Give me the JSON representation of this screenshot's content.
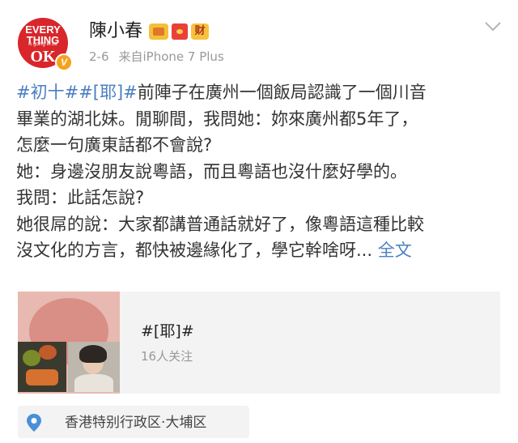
{
  "header": {
    "avatar": {
      "line1": "EVERY",
      "line2": "THING",
      "line3": "is going to be",
      "line4": "OK",
      "verified_mark": "V"
    },
    "username": "陳小春",
    "badges": [
      "crown-badge",
      "red-envelope-badge",
      "cai-badge"
    ],
    "badge_cai_label": "财",
    "date": "2-6",
    "source": "来自iPhone 7 Plus",
    "menu_icon": "chevron-down-icon"
  },
  "post": {
    "line1": {
      "tag": "#初十##[耶]#",
      "text": "前陣子在廣州一個飯局認識了一個川音"
    },
    "line2": "畢業的湖北妹。閒聊間，我問她：妳來廣州都5年了，",
    "line3": "怎麼一句廣東話都不會說?",
    "line4": "她：身邊沒朋友說粵語，而且粵語也沒什麼好學的。",
    "line5": "我問：此話怎說?",
    "line6": "她很屌的說：大家都講普通話就好了，像粵語這種比較",
    "line7": {
      "text": "沒文化的方言，都快被邊緣化了，學它幹啥呀...",
      "more_link": "全文"
    }
  },
  "topic_card": {
    "title": "#[耶]#",
    "followers": "16人关注"
  },
  "location": {
    "icon": "location-pin-icon",
    "text": "香港特别行政区·大埔区"
  },
  "colors": {
    "link_blue": "#4a7fc1",
    "avatar_red": "#d8262b",
    "verified_orange": "#f6a21c",
    "meta_gray": "#999999",
    "card_bg": "#f3f3f3"
  }
}
